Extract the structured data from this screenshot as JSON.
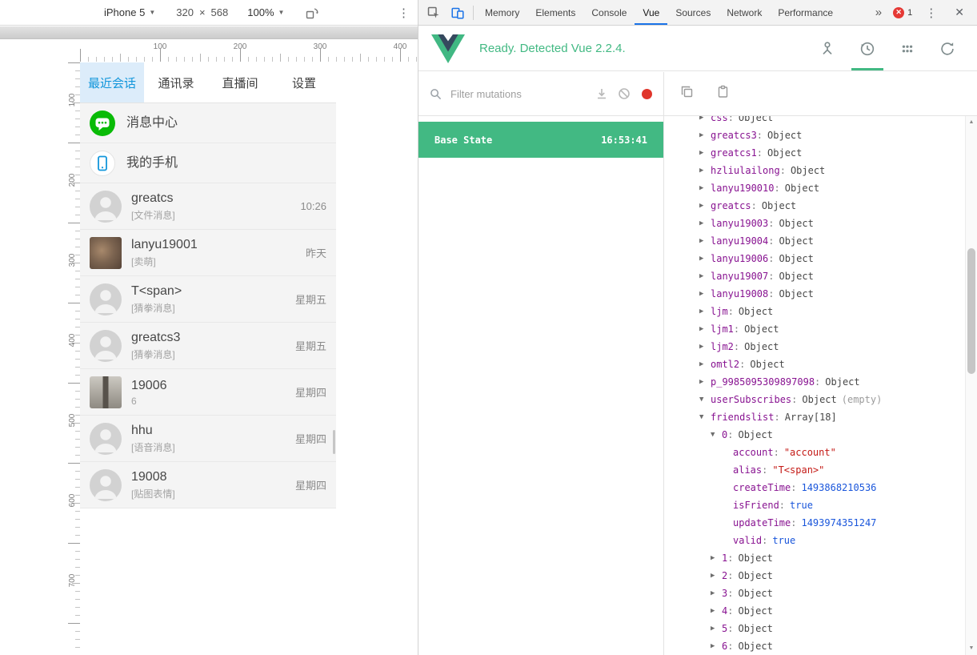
{
  "colors": {
    "vue_green": "#42b983",
    "devtools_blue": "#1a73e8",
    "app_blue": "#1296db",
    "wechat_green": "#09bb07",
    "record_red": "#e0352b",
    "error_red": "#e53935",
    "tree_key": "#881391",
    "tree_string": "#c41a16",
    "tree_number": "#1a56db"
  },
  "device_toolbar": {
    "device": "iPhone 5",
    "width": "320",
    "times": "×",
    "height": "568",
    "zoom": "100%",
    "menu_icon": "⋮"
  },
  "rulers": {
    "horizontal": [
      "100",
      "200",
      "300",
      "400"
    ],
    "vertical": [
      "100",
      "200",
      "300",
      "400",
      "500",
      "600",
      "700"
    ]
  },
  "app": {
    "tabs": [
      {
        "label": "最近会话",
        "active": true
      },
      {
        "label": "通讯录",
        "active": false
      },
      {
        "label": "直播间",
        "active": false
      },
      {
        "label": "设置",
        "active": false
      }
    ],
    "feature_rows": [
      {
        "title": "消息中心",
        "icon": "message-center"
      },
      {
        "title": "我的手机",
        "icon": "my-phone"
      }
    ],
    "chat_rows": [
      {
        "name": "greatcs",
        "subtitle": "[文件消息]",
        "time": "10:26",
        "avatar": "default"
      },
      {
        "name": "lanyu19001",
        "subtitle": "[卖萌]",
        "time": "昨天",
        "avatar": "photo-dog"
      },
      {
        "name": "T<span>",
        "subtitle": "[猜拳消息]",
        "time": "星期五",
        "avatar": "default"
      },
      {
        "name": "greatcs3",
        "subtitle": "[猜拳消息]",
        "time": "星期五",
        "avatar": "default"
      },
      {
        "name": "19006",
        "subtitle": "6",
        "time": "星期四",
        "avatar": "photo-person"
      },
      {
        "name": "hhu",
        "subtitle": "[语音消息]",
        "time": "星期四",
        "avatar": "default"
      },
      {
        "name": "19008",
        "subtitle": "[贴图表情]",
        "time": "星期四",
        "avatar": "default"
      }
    ]
  },
  "devtools": {
    "tabs": [
      {
        "label": "Memory",
        "active": false
      },
      {
        "label": "Elements",
        "active": false
      },
      {
        "label": "Console",
        "active": false
      },
      {
        "label": "Vue",
        "active": true
      },
      {
        "label": "Sources",
        "active": false
      },
      {
        "label": "Network",
        "active": false
      },
      {
        "label": "Performance",
        "active": false
      }
    ],
    "overflow": "»",
    "error_count": "1",
    "menu_icon": "⋮",
    "close_icon": "✕"
  },
  "vue_panel": {
    "status": "Ready. Detected Vue 2.2.4."
  },
  "vuex": {
    "filter_placeholder": "Filter mutations",
    "base_state": {
      "label": "Base State",
      "time": "16:53:41"
    }
  },
  "state_tree": {
    "items": [
      {
        "level": 0,
        "arrow": "right",
        "key": "css",
        "value": "Object",
        "vtype": "object"
      },
      {
        "level": 0,
        "arrow": "right",
        "key": "greatcs3",
        "value": "Object",
        "vtype": "object"
      },
      {
        "level": 0,
        "arrow": "right",
        "key": "greatcs1",
        "value": "Object",
        "vtype": "object"
      },
      {
        "level": 0,
        "arrow": "right",
        "key": "hzliulailong",
        "value": "Object",
        "vtype": "object"
      },
      {
        "level": 0,
        "arrow": "right",
        "key": "lanyu190010",
        "value": "Object",
        "vtype": "object"
      },
      {
        "level": 0,
        "arrow": "right",
        "key": "greatcs",
        "value": "Object",
        "vtype": "object"
      },
      {
        "level": 0,
        "arrow": "right",
        "key": "lanyu19003",
        "value": "Object",
        "vtype": "object"
      },
      {
        "level": 0,
        "arrow": "right",
        "key": "lanyu19004",
        "value": "Object",
        "vtype": "object"
      },
      {
        "level": 0,
        "arrow": "right",
        "key": "lanyu19006",
        "value": "Object",
        "vtype": "object"
      },
      {
        "level": 0,
        "arrow": "right",
        "key": "lanyu19007",
        "value": "Object",
        "vtype": "object"
      },
      {
        "level": 0,
        "arrow": "right",
        "key": "lanyu19008",
        "value": "Object",
        "vtype": "object"
      },
      {
        "level": 0,
        "arrow": "right",
        "key": "ljm",
        "value": "Object",
        "vtype": "object"
      },
      {
        "level": 0,
        "arrow": "right",
        "key": "ljm1",
        "value": "Object",
        "vtype": "object"
      },
      {
        "level": 0,
        "arrow": "right",
        "key": "ljm2",
        "value": "Object",
        "vtype": "object"
      },
      {
        "level": 0,
        "arrow": "right",
        "key": "omtl2",
        "value": "Object",
        "vtype": "object"
      },
      {
        "level": 0,
        "arrow": "right",
        "key": "p_9985095309897098",
        "value": "Object",
        "vtype": "object"
      },
      {
        "level": 0,
        "arrow": "down",
        "key": "userSubscribes",
        "value": "Object",
        "vtype": "object",
        "note": "(empty)"
      },
      {
        "level": 0,
        "arrow": "down",
        "key": "friendslist",
        "value": "Array[18]",
        "vtype": "object"
      },
      {
        "level": 1,
        "arrow": "down",
        "key": "0",
        "value": "Object",
        "vtype": "object"
      },
      {
        "level": 2,
        "arrow": "none",
        "key": "account",
        "value": "\"account\"",
        "vtype": "string"
      },
      {
        "level": 2,
        "arrow": "none",
        "key": "alias",
        "value": "\"T<span>\"",
        "vtype": "string"
      },
      {
        "level": 2,
        "arrow": "none",
        "key": "createTime",
        "value": "1493868210536",
        "vtype": "number"
      },
      {
        "level": 2,
        "arrow": "none",
        "key": "isFriend",
        "value": "true",
        "vtype": "boolean"
      },
      {
        "level": 2,
        "arrow": "none",
        "key": "updateTime",
        "value": "1493974351247",
        "vtype": "number"
      },
      {
        "level": 2,
        "arrow": "none",
        "key": "valid",
        "value": "true",
        "vtype": "boolean"
      },
      {
        "level": 1,
        "arrow": "right",
        "key": "1",
        "value": "Object",
        "vtype": "object"
      },
      {
        "level": 1,
        "arrow": "right",
        "key": "2",
        "value": "Object",
        "vtype": "object"
      },
      {
        "level": 1,
        "arrow": "right",
        "key": "3",
        "value": "Object",
        "vtype": "object"
      },
      {
        "level": 1,
        "arrow": "right",
        "key": "4",
        "value": "Object",
        "vtype": "object"
      },
      {
        "level": 1,
        "arrow": "right",
        "key": "5",
        "value": "Object",
        "vtype": "object"
      },
      {
        "level": 1,
        "arrow": "right",
        "key": "6",
        "value": "Object",
        "vtype": "object"
      }
    ]
  }
}
